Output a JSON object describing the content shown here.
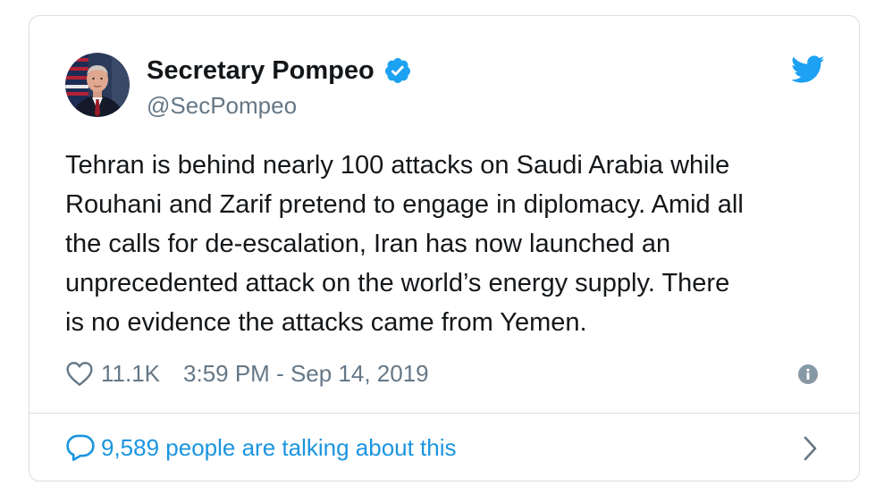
{
  "author": {
    "display_name": "Secretary Pompeo",
    "handle": "@SecPompeo",
    "verified": true
  },
  "tweet": {
    "text": "Tehran is behind nearly 100 attacks on Saudi Arabia while\nRouhani and Zarif pretend to engage in diplomacy. Amid all\nthe calls for de-escalation, Iran has now launched an\nunprecedented attack on the world’s energy supply.  There\nis no evidence the attacks came from Yemen.",
    "likes": "11.1K",
    "timestamp": "3:59 PM - Sep 14, 2019"
  },
  "footer": {
    "talking_label": "9,589 people are talking about this"
  },
  "icons": {
    "verified": "verified-badge-icon",
    "bird": "twitter-bird-icon",
    "heart": "heart-icon",
    "info": "info-icon",
    "reply": "speech-bubble-icon",
    "chevron": "chevron-right-icon"
  },
  "colors": {
    "brand_blue": "#1da1f2",
    "link_blue": "#1b95e0",
    "text": "#14171a",
    "muted": "#657786",
    "border": "#d8dde1"
  }
}
